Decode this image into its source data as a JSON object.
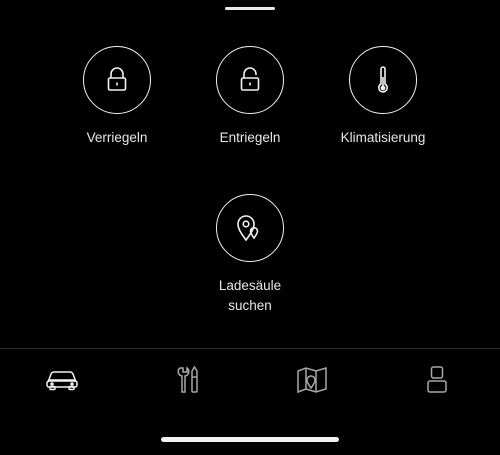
{
  "actions": [
    {
      "label": "Verriegeln",
      "icon": "lock-closed-icon"
    },
    {
      "label": "Entriegeln",
      "icon": "lock-open-icon"
    },
    {
      "label": "Klimatisierung",
      "icon": "thermometer-icon"
    },
    {
      "label": "Ladesäule\nsuchen",
      "icon": "charging-station-location-icon"
    }
  ],
  "bottom_nav": [
    {
      "icon": "car-icon",
      "active": true
    },
    {
      "icon": "service-tools-icon",
      "active": false
    },
    {
      "icon": "map-icon",
      "active": false
    },
    {
      "icon": "profile-icon",
      "active": false
    }
  ],
  "colors": {
    "background": "#000000",
    "foreground": "#f2f2f2",
    "divider": "#2b2b2b"
  }
}
